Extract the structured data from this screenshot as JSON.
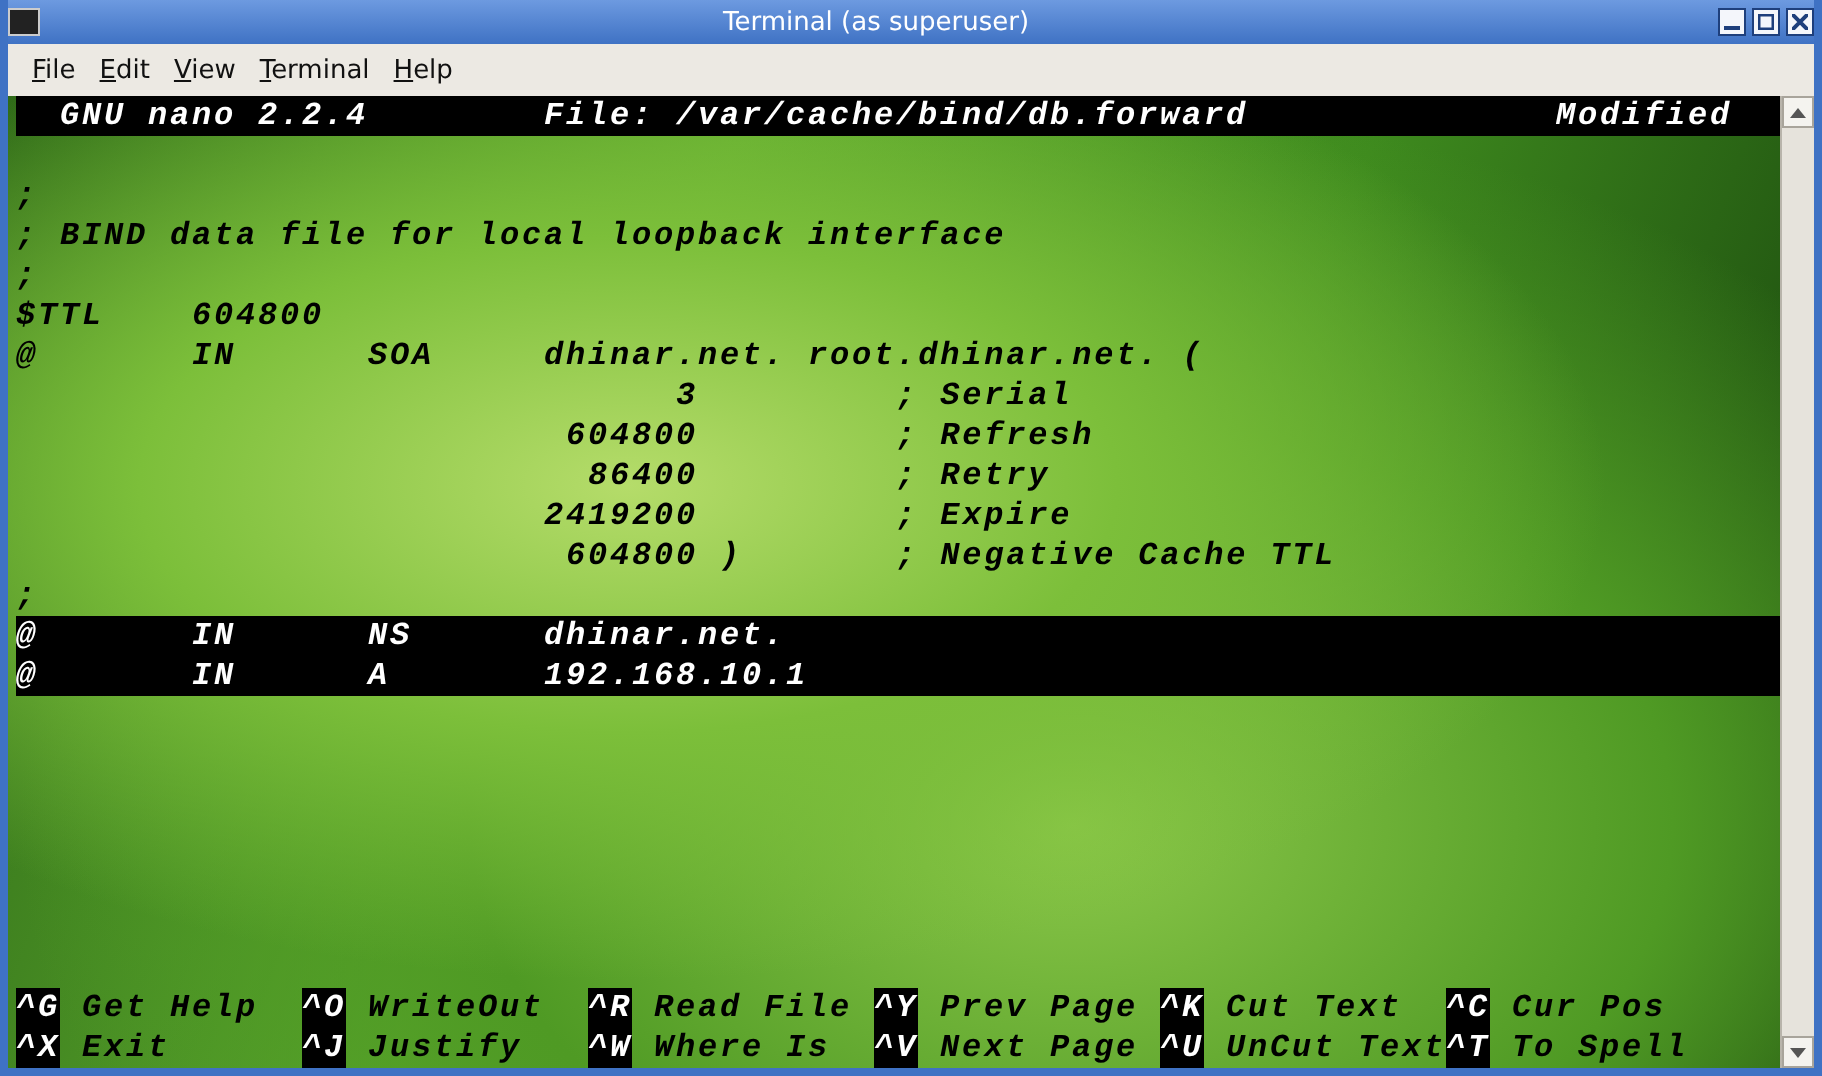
{
  "window": {
    "title": "Terminal (as superuser)"
  },
  "menu": [
    "File",
    "Edit",
    "View",
    "Terminal",
    "Help"
  ],
  "nano_header": {
    "program": "GNU nano 2.2.4",
    "file": "File: /var/cache/bind/db.forward",
    "status": "Modified"
  },
  "lines": [
    {
      "text": ";",
      "marked": false
    },
    {
      "text": "; BIND data file for local loopback interface",
      "marked": false
    },
    {
      "text": ";",
      "marked": false
    },
    {
      "text": "$TTL    604800",
      "marked": false
    },
    {
      "text": "@       IN      SOA     dhinar.net. root.dhinar.net. (",
      "marked": false
    },
    {
      "text": "                              3         ; Serial",
      "marked": false
    },
    {
      "text": "                         604800         ; Refresh",
      "marked": false
    },
    {
      "text": "                          86400         ; Retry",
      "marked": false
    },
    {
      "text": "                        2419200         ; Expire",
      "marked": false
    },
    {
      "text": "                         604800 )       ; Negative Cache TTL",
      "marked": false
    },
    {
      "text": ";",
      "marked": false
    },
    {
      "text": "@       IN      NS      dhinar.net.",
      "marked": true
    },
    {
      "text": "@       IN      A       192.168.10.1",
      "marked": true
    }
  ],
  "shortcuts": [
    {
      "key": "^G",
      "label": "Get Help"
    },
    {
      "key": "^O",
      "label": "WriteOut"
    },
    {
      "key": "^R",
      "label": "Read File"
    },
    {
      "key": "^Y",
      "label": "Prev Page"
    },
    {
      "key": "^K",
      "label": "Cut Text"
    },
    {
      "key": "^C",
      "label": "Cur Pos"
    },
    {
      "key": "^X",
      "label": "Exit"
    },
    {
      "key": "^J",
      "label": "Justify"
    },
    {
      "key": "^W",
      "label": "Where Is"
    },
    {
      "key": "^V",
      "label": "Next Page"
    },
    {
      "key": "^U",
      "label": "UnCut Text"
    },
    {
      "key": "^T",
      "label": "To Spell"
    }
  ]
}
